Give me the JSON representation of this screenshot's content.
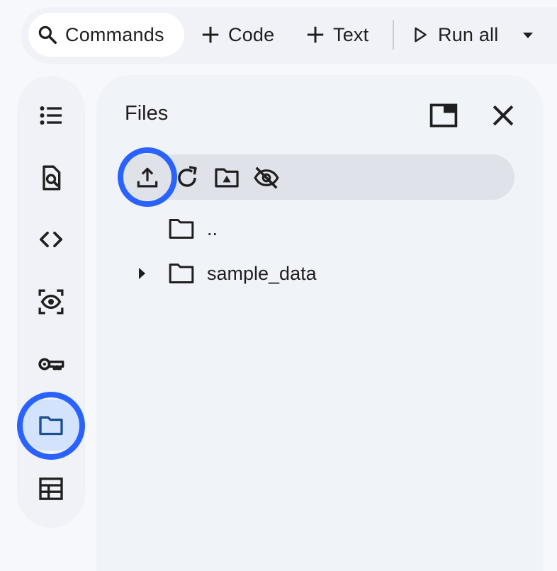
{
  "toolbar": {
    "commands_label": "Commands",
    "code_label": "Code",
    "text_label": "Text",
    "run_all_label": "Run all"
  },
  "rail": {
    "items": [
      {
        "icon": "table-of-contents-icon"
      },
      {
        "icon": "find-replace-icon"
      },
      {
        "icon": "code-snippets-icon"
      },
      {
        "icon": "variables-icon"
      },
      {
        "icon": "secrets-key-icon"
      },
      {
        "icon": "folder-icon",
        "active": true
      },
      {
        "icon": "data-table-icon"
      }
    ]
  },
  "files_panel": {
    "title": "Files",
    "tree": [
      {
        "label": "..",
        "expandable": false
      },
      {
        "label": "sample_data",
        "expandable": true
      }
    ]
  },
  "colors": {
    "highlight_ring": "#2962ff",
    "rail_active_bg": "#d3e3fd",
    "active_icon": "#1b4f8f"
  }
}
